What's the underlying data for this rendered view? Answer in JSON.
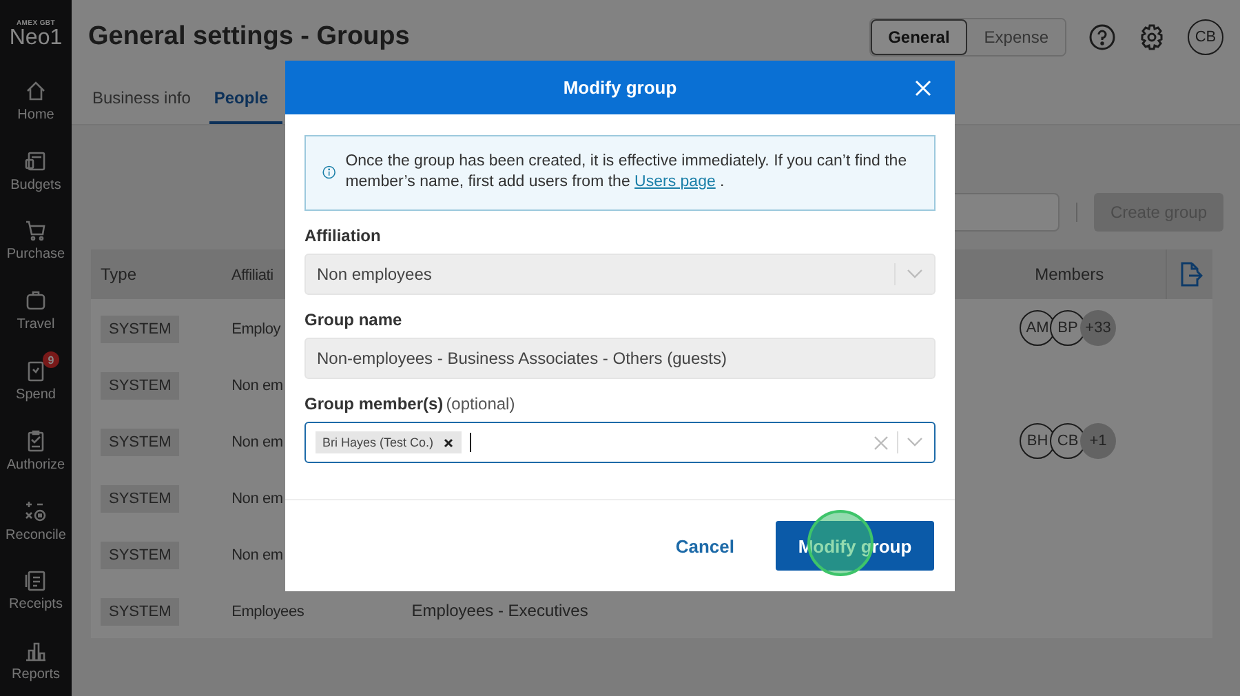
{
  "sidebar": {
    "logo": {
      "brand": "AMEX GBT",
      "name": "Neo1"
    },
    "items": [
      {
        "label": "Home"
      },
      {
        "label": "Budgets"
      },
      {
        "label": "Purchase"
      },
      {
        "label": "Travel"
      },
      {
        "label": "Spend",
        "badge": "9"
      },
      {
        "label": "Authorize"
      },
      {
        "label": "Reconcile"
      },
      {
        "label": "Receipts"
      },
      {
        "label": "Reports"
      }
    ]
  },
  "header": {
    "title": "General settings - Groups",
    "scope_toggle": [
      {
        "label": "General",
        "selected": true
      },
      {
        "label": "Expense",
        "selected": false
      }
    ],
    "avatar": "CB"
  },
  "tabs": [
    {
      "label": "Business info",
      "selected": false
    },
    {
      "label": "People",
      "selected": true
    }
  ],
  "toolbar": {
    "create_button": {
      "label": "Create group",
      "disabled": true
    }
  },
  "table": {
    "columns": {
      "type": "Type",
      "affiliation": "Affiliati",
      "members": "Members"
    },
    "rows": [
      {
        "type": "SYSTEM",
        "affiliation": "Employ",
        "members": [
          "AM",
          "BP"
        ],
        "more": "+33"
      },
      {
        "type": "SYSTEM",
        "affiliation": "Non em"
      },
      {
        "type": "SYSTEM",
        "affiliation": "Non em",
        "members": [
          "BH",
          "CB"
        ],
        "more": "+1"
      },
      {
        "type": "SYSTEM",
        "affiliation": "Non em"
      },
      {
        "type": "SYSTEM",
        "affiliation": "Non em"
      },
      {
        "type": "SYSTEM",
        "affiliation": "Employees",
        "column_3": "Employees - Executives"
      }
    ]
  },
  "modal": {
    "title": "Modify group",
    "notice": {
      "text": "Once the group has been created, it is effective immediately. If you can’t find the member’s name, first add users from the",
      "link": "Users page",
      "after": "."
    },
    "affiliation": {
      "label": "Affiliation",
      "value": "Non employees",
      "disabled": true
    },
    "group_name": {
      "label": "Group name",
      "value": "Non-employees - Business Associates - Others (guests)",
      "disabled": true
    },
    "members": {
      "label": "Group member(s)",
      "hint": "(optional)",
      "chips": [
        "Bri Hayes (Test Co.)"
      ],
      "focused": true
    },
    "cancel": "Cancel",
    "submit": "Modify group"
  }
}
